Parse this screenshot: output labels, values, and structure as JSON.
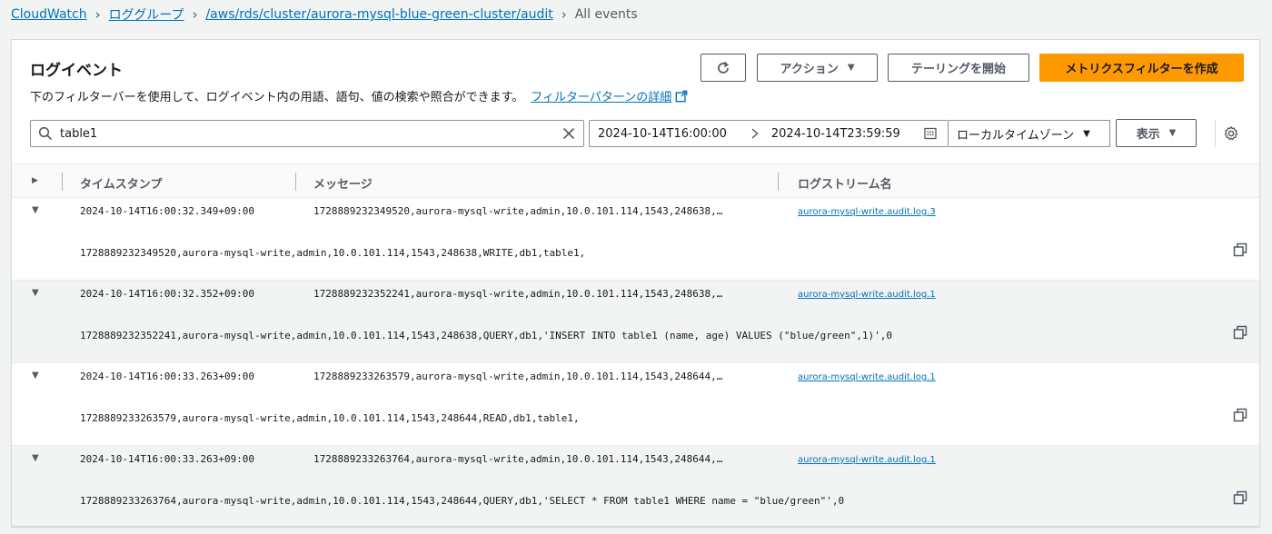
{
  "breadcrumb": {
    "items": [
      "CloudWatch",
      "ロググループ",
      "/aws/rds/cluster/aurora-mysql-blue-green-cluster/audit"
    ],
    "current": "All events"
  },
  "panel": {
    "title": "ログイベント",
    "description": "下のフィルターバーを使用して、ログイベント内の用語、語句、値の検索や照合ができます。",
    "description_link": "フィルターパターンの詳細"
  },
  "toolbar": {
    "actions_label": "アクション",
    "tailing_label": "テーリングを開始",
    "create_metric_filter_label": "メトリクスフィルターを作成"
  },
  "filter": {
    "search_value": "table1",
    "date_start": "2024-10-14T16:00:00",
    "date_end": "2024-10-14T23:59:59",
    "timezone": "ローカルタイムゾーン",
    "view_label": "表示"
  },
  "table": {
    "columns": [
      "タイムスタンプ",
      "メッセージ",
      "ログストリーム名"
    ],
    "rows": [
      {
        "timestamp": "2024-10-14T16:00:32.349+09:00",
        "message_short": "1728889232349520,aurora-mysql-write,admin,10.0.101.114,1543,248638,…",
        "stream": "aurora-mysql-write.audit.log.3",
        "message_full": "1728889232349520,aurora-mysql-write,admin,10.0.101.114,1543,248638,WRITE,db1,table1,"
      },
      {
        "timestamp": "2024-10-14T16:00:32.352+09:00",
        "message_short": "1728889232352241,aurora-mysql-write,admin,10.0.101.114,1543,248638,…",
        "stream": "aurora-mysql-write.audit.log.1",
        "message_full": "1728889232352241,aurora-mysql-write,admin,10.0.101.114,1543,248638,QUERY,db1,'INSERT INTO table1 (name, age) VALUES (\"blue/green\",1)',0"
      },
      {
        "timestamp": "2024-10-14T16:00:33.263+09:00",
        "message_short": "1728889233263579,aurora-mysql-write,admin,10.0.101.114,1543,248644,…",
        "stream": "aurora-mysql-write.audit.log.1",
        "message_full": "1728889233263579,aurora-mysql-write,admin,10.0.101.114,1543,248644,READ,db1,table1,"
      },
      {
        "timestamp": "2024-10-14T16:00:33.263+09:00",
        "message_short": "1728889233263764,aurora-mysql-write,admin,10.0.101.114,1543,248644,…",
        "stream": "aurora-mysql-write.audit.log.1",
        "message_full": "1728889233263764,aurora-mysql-write,admin,10.0.101.114,1543,248644,QUERY,db1,'SELECT * FROM table1 WHERE name = \"blue/green\"',0"
      }
    ]
  },
  "colors": {
    "link": "#0073bb",
    "primary_button": "#ff9900",
    "panel_border": "#d5dbdb"
  }
}
